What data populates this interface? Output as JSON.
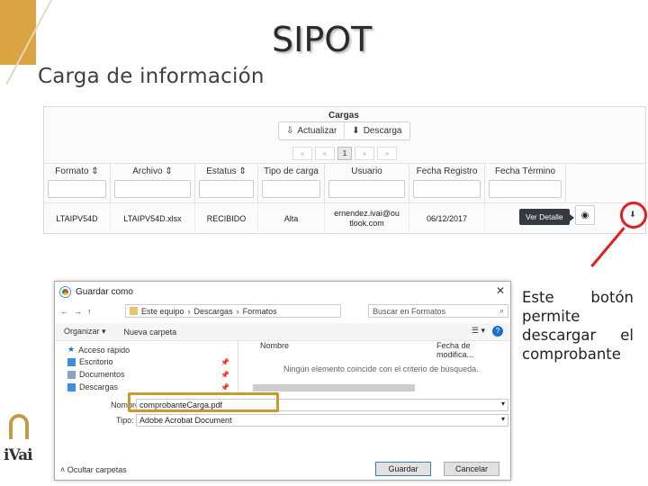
{
  "slide": {
    "title": "SIPOT",
    "subtitle": "Carga de información",
    "note_lines": [
      "Este botón",
      "permite",
      "descargar el",
      "comprobante"
    ]
  },
  "sipot": {
    "section_title": "Cargas",
    "buttons": {
      "refresh": "Actualizar",
      "download": "Descarga"
    },
    "pager": [
      "«",
      "«",
      "1",
      "»",
      "»"
    ],
    "columns": [
      "Formato ⇕",
      "Archivo ⇕",
      "Estatus ⇕",
      "Tipo de carga",
      "Usuario",
      "Fecha Registro",
      "Fecha Término"
    ],
    "row": {
      "formato": "LTAIPV54D",
      "archivo": "LTAIPV54D.xlsx",
      "estatus": "RECIBIDO",
      "tipo": "Alta",
      "usuario": "ernendez.ivai@ou tlook.com",
      "fecha_registro": "06/12/2017",
      "fecha_termino": ""
    },
    "tooltip": "Ver Detalle"
  },
  "dialog": {
    "title": "Guardar como",
    "path": [
      "Este equipo",
      "Descargas",
      "Formatos"
    ],
    "search_placeholder": "Buscar en Formatos",
    "toolbar": {
      "organize": "Organizar ▾",
      "new_folder": "Nueva carpeta"
    },
    "sidebar": [
      "Acceso rápido",
      "Escritorio",
      "Documentos",
      "Descargas"
    ],
    "columns": {
      "name": "Nombre",
      "date": "Fecha de modifica..."
    },
    "empty_message": "Ningún elemento coincide con el criterio de búsqueda.",
    "name_label": "Nombre:",
    "name_value": "comprobanteCarga.pdf",
    "type_label": "Tipo:",
    "type_value": "Adobe Acrobat Document",
    "hide_folders": "Ocultar carpetas",
    "save_button": "Guardar",
    "cancel_button": "Cancelar"
  },
  "logo": {
    "text": "iVai"
  },
  "colors": {
    "gold": "#d9a441",
    "annotation_red": "#e0201c",
    "highlight_gold": "#c99a2e"
  }
}
